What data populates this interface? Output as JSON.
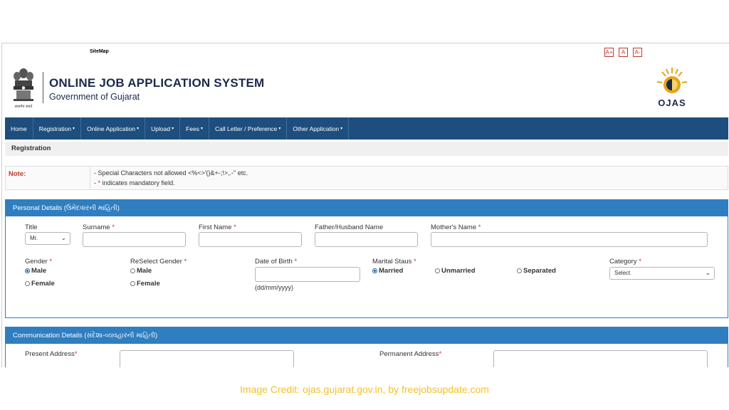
{
  "topbar": {
    "sitemap": "SiteMap",
    "font_buttons": [
      "A+",
      "A",
      "A-"
    ]
  },
  "header": {
    "title": "ONLINE JOB APPLICATION SYSTEM",
    "subtitle": "Government of Gujarat",
    "emblem_motto": "सत्यमेव जयते",
    "logo_text": "OJAS"
  },
  "nav": [
    {
      "label": "Home",
      "dropdown": false
    },
    {
      "label": "Registration",
      "dropdown": true
    },
    {
      "label": "Online Application",
      "dropdown": true
    },
    {
      "label": "Upload",
      "dropdown": true
    },
    {
      "label": "Fees",
      "dropdown": true
    },
    {
      "label": "Call Letter / Preference",
      "dropdown": true
    },
    {
      "label": "Other Application",
      "dropdown": true
    }
  ],
  "breadcrumb": "Registration",
  "note": {
    "label": "Note:",
    "line1": "- Special Characters not allowed <%<>'()&+-;!>,.-\" etc.",
    "line2_prefix": "- ",
    "line2_star": "*",
    "line2_suffix": " indicates mandatory field."
  },
  "personal": {
    "heading": "Personal Details (ઉમેદવારની માહિતી)",
    "title_label": "Title",
    "title_value": "Mr.",
    "surname_label": "Surname",
    "first_name_label": "First Name",
    "father_label": "Father/Husband Name",
    "mother_label": "Mother's Name",
    "gender_label": "Gender",
    "gender_options": [
      "Male",
      "Female"
    ],
    "gender_selected": "Male",
    "reselect_gender_label": "ReSelect Gender",
    "reselect_options": [
      "Male",
      "Female"
    ],
    "dob_label": "Date of Birth",
    "dob_hint": "(dd/mm/yyyy)",
    "marital_label": "Marital Staus",
    "marital_options": [
      "Married",
      "Unmarried",
      "Separated"
    ],
    "marital_selected": "Married",
    "category_label": "Category",
    "category_value": "Select"
  },
  "communication": {
    "heading": "Communication Details (સંદેશા-વ્યવહારની માહિતી)",
    "present_label": "Present Address",
    "permanent_label": "Permanent Address"
  },
  "credit": "Image Credit: ojas.gujarat.gov.in, by freejobsupdate.com",
  "colors": {
    "nav": "#1d4e7e",
    "panel_header": "#2f7ec0",
    "mandatory": "#c0392b",
    "credit": "#f2c12e"
  }
}
